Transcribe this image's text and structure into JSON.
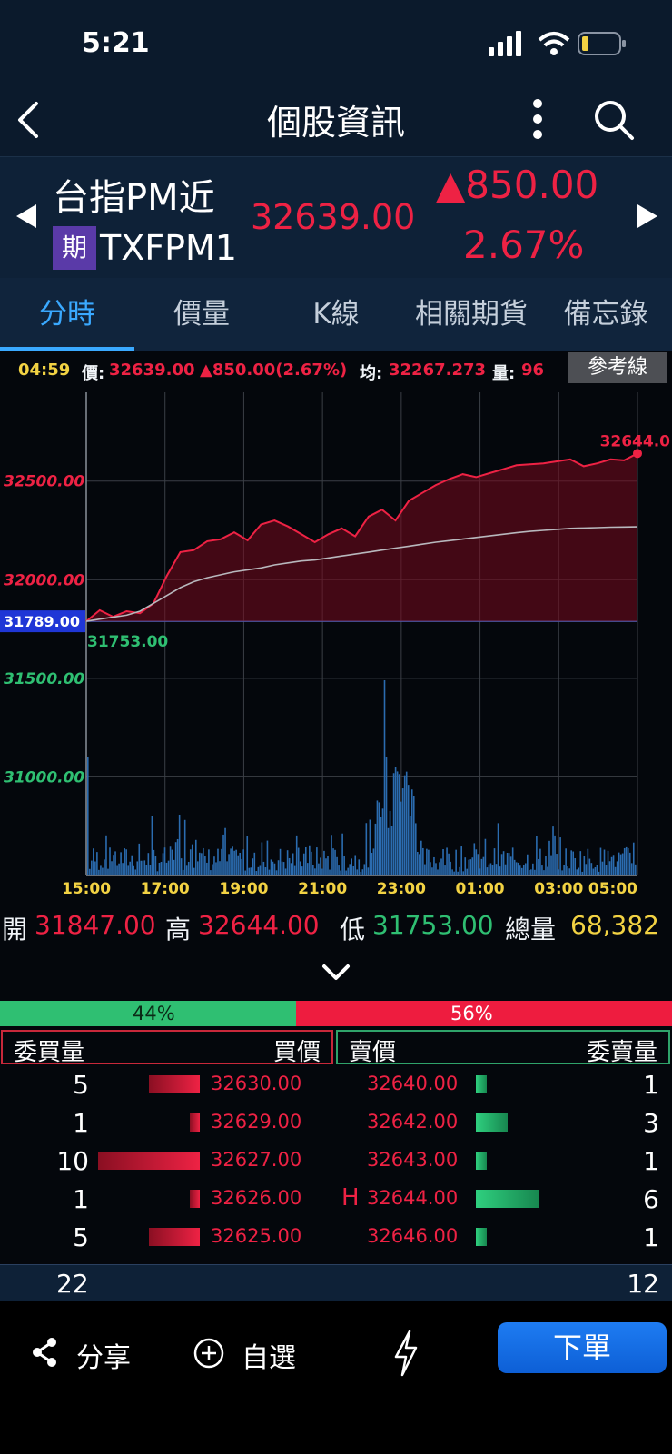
{
  "status_bar": {
    "time": "5:21"
  },
  "nav": {
    "title": "個股資訊"
  },
  "quote": {
    "name": "台指PM近",
    "type_badge": "期",
    "code": "TXFPM1",
    "price": "32639.00",
    "change": "▲850.00",
    "change_pct": "2.67%"
  },
  "tabs": [
    "分時",
    "價量",
    "K線",
    "相關期貨",
    "備忘錄"
  ],
  "info_bar": {
    "time": "04:59",
    "price_label": "價:",
    "price": "32639.00",
    "change": "▲850.00(2.67%)",
    "avg_label": "均:",
    "avg": "32267.273",
    "vol_label": "量:",
    "vol": "96",
    "ref_button": "參考線"
  },
  "chart_data": {
    "type": "line",
    "x_tick_labels": [
      "15:00",
      "17:00",
      "19:00",
      "21:00",
      "23:00",
      "01:00",
      "03:00",
      "05:00"
    ],
    "y_tick_labels_up": [
      "32500.00",
      "32000.00"
    ],
    "y_tick_labels_down": [
      "31500.00",
      "31000.00"
    ],
    "ylim": [
      30500,
      32950
    ],
    "reference_price": "31789.00",
    "high_label": "32644.0",
    "low_label": "31753.00",
    "series": [
      {
        "values": [
          31789,
          31845,
          31812,
          31840,
          31830,
          31880,
          32020,
          32140,
          32150,
          32195,
          32205,
          32240,
          32200,
          32280,
          32300,
          32270,
          32230,
          32190,
          32230,
          32260,
          32220,
          32320,
          32355,
          32300,
          32400,
          32440,
          32480,
          32510,
          32535,
          32520,
          32540,
          32560,
          32580,
          32585,
          32590,
          32600,
          32610,
          32575,
          32590,
          32610,
          32605,
          32640
        ]
      },
      {
        "values": [
          31789,
          31800,
          31810,
          31820,
          31840,
          31880,
          31920,
          31960,
          31990,
          32010,
          32025,
          32040,
          32050,
          32060,
          32075,
          32085,
          32095,
          32100,
          32110,
          32120,
          32130,
          32140,
          32150,
          32160,
          32170,
          32180,
          32190,
          32198,
          32206,
          32214,
          32222,
          32230,
          32238,
          32245,
          32250,
          32255,
          32260,
          32262,
          32264,
          32266,
          32267,
          32268
        ]
      }
    ]
  },
  "ohlc": {
    "open_label": "開",
    "open": "31847.00",
    "high_label": "高",
    "high": "32644.00",
    "low_label": "低",
    "low": "31753.00",
    "vol_label": "總量",
    "vol": "68,382"
  },
  "ratio": {
    "buy_pct": "44%",
    "sell_pct": "56%",
    "buy_fraction": 0.44
  },
  "book": {
    "buy_qty_header": "委買量",
    "buy_price_header": "買價",
    "sell_price_header": "賣價",
    "sell_qty_header": "委賣量",
    "rows": [
      {
        "bid_qty": "5",
        "bid": "32630.00",
        "ask": "32640.00",
        "ask_qty": "1",
        "mark": ""
      },
      {
        "bid_qty": "1",
        "bid": "32629.00",
        "ask": "32642.00",
        "ask_qty": "3",
        "mark": ""
      },
      {
        "bid_qty": "10",
        "bid": "32627.00",
        "ask": "32643.00",
        "ask_qty": "1",
        "mark": ""
      },
      {
        "bid_qty": "1",
        "bid": "32626.00",
        "ask": "32644.00",
        "ask_qty": "6",
        "mark": "H"
      },
      {
        "bid_qty": "5",
        "bid": "32625.00",
        "ask": "32646.00",
        "ask_qty": "1",
        "mark": ""
      }
    ],
    "bid_total": "22",
    "ask_total": "12"
  },
  "bottom": {
    "share_label": "分享",
    "watch_label": "自選",
    "order_label": "下單"
  },
  "colors": {
    "up": "#ee2244",
    "down": "#2fbf72",
    "accent": "#3aa9ff",
    "volume": "#2b6cb0"
  },
  "icons": [
    "back-icon",
    "more-icon",
    "search-icon",
    "share-icon",
    "add-circle-icon",
    "lightning-icon"
  ]
}
